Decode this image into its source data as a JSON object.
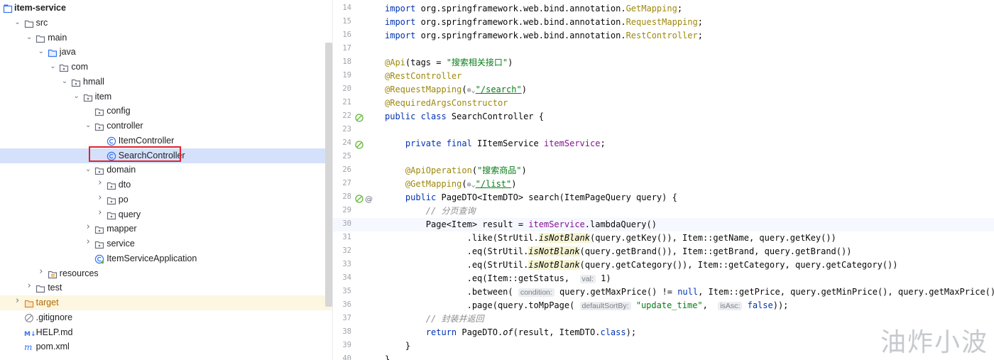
{
  "project_tree": [
    {
      "label": "item-service",
      "depth": 0,
      "arrow": "",
      "icon": "module",
      "bold": true
    },
    {
      "label": "src",
      "depth": 1,
      "arrow": "down",
      "icon": "folder"
    },
    {
      "label": "main",
      "depth": 2,
      "arrow": "down",
      "icon": "folder"
    },
    {
      "label": "java",
      "depth": 3,
      "arrow": "down",
      "icon": "source-folder"
    },
    {
      "label": "com",
      "depth": 4,
      "arrow": "down",
      "icon": "package"
    },
    {
      "label": "hmall",
      "depth": 5,
      "arrow": "down",
      "icon": "package"
    },
    {
      "label": "item",
      "depth": 6,
      "arrow": "down",
      "icon": "package"
    },
    {
      "label": "config",
      "depth": 7,
      "arrow": "",
      "icon": "package"
    },
    {
      "label": "controller",
      "depth": 7,
      "arrow": "down",
      "icon": "package"
    },
    {
      "label": "ItemController",
      "depth": 8,
      "arrow": "",
      "icon": "class"
    },
    {
      "label": "SearchController",
      "depth": 8,
      "arrow": "",
      "icon": "class",
      "selected": true
    },
    {
      "label": "domain",
      "depth": 7,
      "arrow": "down",
      "icon": "package"
    },
    {
      "label": "dto",
      "depth": 8,
      "arrow": "right",
      "icon": "package"
    },
    {
      "label": "po",
      "depth": 8,
      "arrow": "right",
      "icon": "package"
    },
    {
      "label": "query",
      "depth": 8,
      "arrow": "right",
      "icon": "package"
    },
    {
      "label": "mapper",
      "depth": 7,
      "arrow": "right",
      "icon": "package"
    },
    {
      "label": "service",
      "depth": 7,
      "arrow": "right",
      "icon": "package"
    },
    {
      "label": "ItemServiceApplication",
      "depth": 7,
      "arrow": "",
      "icon": "spring-class"
    },
    {
      "label": "resources",
      "depth": 3,
      "arrow": "right",
      "icon": "resources-folder"
    },
    {
      "label": "test",
      "depth": 2,
      "arrow": "right",
      "icon": "folder"
    },
    {
      "label": "target",
      "depth": 1,
      "arrow": "right",
      "icon": "excluded-folder",
      "orange": true
    },
    {
      "label": ".gitignore",
      "depth": 1,
      "arrow": "",
      "icon": "gitignore-file"
    },
    {
      "label": "HELP.md",
      "depth": 1,
      "arrow": "",
      "icon": "markdown-file"
    },
    {
      "label": "pom.xml",
      "depth": 1,
      "arrow": "",
      "icon": "maven-file"
    }
  ],
  "code_lines": [
    {
      "n": "14",
      "html": "<span class='k'>import</span> org.springframework.web.bind.annotation.<span class='an'>GetMapping</span>;"
    },
    {
      "n": "15",
      "html": "<span class='k'>import</span> org.springframework.web.bind.annotation.<span class='an'>RequestMapping</span>;"
    },
    {
      "n": "16",
      "html": "<span class='k'>import</span> org.springframework.web.bind.annotation.<span class='an'>RestController</span>;"
    },
    {
      "n": "17",
      "html": ""
    },
    {
      "n": "18",
      "html": "<span class='an'>@Api</span>(tags = <span class='st'>\"搜索相关接口\"</span>)"
    },
    {
      "n": "19",
      "html": "<span class='an'>@RestController</span>"
    },
    {
      "n": "20",
      "html": "<span class='an'>@RequestMapping</span>(<span class='glob'>⊕⌄</span><span class='lnk'>\"/search\"</span>)"
    },
    {
      "n": "21",
      "html": "<span class='an'>@RequiredArgsConstructor</span>"
    },
    {
      "n": "22",
      "html": "<span class='k'>public class</span> SearchController {",
      "gutter": [
        "bean-icon"
      ]
    },
    {
      "n": "23",
      "html": ""
    },
    {
      "n": "24",
      "html": "    <span class='k'>private final</span> IItemService <span class='fd'>itemService</span>;",
      "gutter": [
        "bean-icon"
      ]
    },
    {
      "n": "25",
      "html": ""
    },
    {
      "n": "26",
      "html": "    <span class='an'>@ApiOperation</span>(<span class='st'>\"搜索商品\"</span>)"
    },
    {
      "n": "27",
      "html": "    <span class='an'>@GetMapping</span>(<span class='glob'>⊕⌄</span><span class='lnk'>\"/list\"</span>)"
    },
    {
      "n": "28",
      "html": "    <span class='k'>public</span> PageDTO&lt;ItemDTO&gt; search(ItemPageQuery query) {",
      "gutter": [
        "bean-icon",
        "at-icon"
      ]
    },
    {
      "n": "29",
      "html": "        <span class='cm'>// 分页查询</span>"
    },
    {
      "n": "30",
      "html": "        Page&lt;Item&gt; result = <span class='fd'>itemService</span>.lambdaQuery()",
      "current": true
    },
    {
      "n": "31",
      "html": "                .like(StrUtil.<span class='it hl'>isNotBlank</span>(query.getKey()), Item::getName, query.getKey())"
    },
    {
      "n": "32",
      "html": "                .eq(StrUtil.<span class='it hl'>isNotBlank</span>(query.getBrand()), Item::getBrand, query.getBrand())"
    },
    {
      "n": "33",
      "html": "                .eq(StrUtil.<span class='it hl'>isNotBlank</span>(query.getCategory()), Item::getCategory, query.getCategory())"
    },
    {
      "n": "34",
      "html": "                .eq(Item::getStatus,  <span class='hint'>val:</span> 1)"
    },
    {
      "n": "35",
      "html": "                .between( <span class='hint'>condition:</span> query.getMaxPrice() != <span class='k'>null</span>, Item::getPrice, query.getMinPrice(), query.getMaxPrice())"
    },
    {
      "n": "36",
      "html": "                .page(query.toMpPage( <span class='hint'>defaultSortBy:</span> <span class='st'>\"update_time\"</span>,  <span class='hint'>isAsc:</span> <span class='k'>false</span>));"
    },
    {
      "n": "37",
      "html": "        <span class='cm'>// 封装并返回</span>"
    },
    {
      "n": "38",
      "html": "        <span class='k'>return</span> PageDTO.<span class='it'>of</span>(result, ItemDTO.<span class='k'>class</span>);"
    },
    {
      "n": "39",
      "html": "    }"
    },
    {
      "n": "40",
      "html": "}"
    }
  ],
  "watermark": "油炸小波",
  "colors": {
    "keyword": "#0033b3",
    "annotation": "#9e880d",
    "string": "#067d17",
    "field": "#871094",
    "selection": "#d5e1fb",
    "highlight_border": "#e0242b"
  }
}
